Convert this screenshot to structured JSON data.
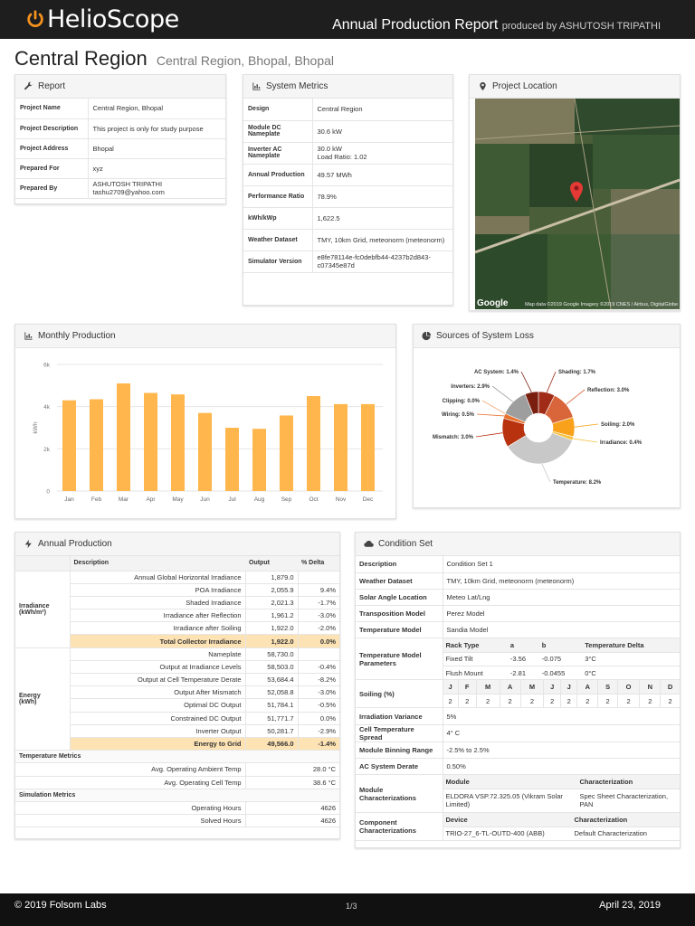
{
  "header": {
    "logo": "HelioScope",
    "title": "Annual Production Report",
    "produced_by": "produced by ASHUTOSH TRIPATHI"
  },
  "page": {
    "title": "Central Region",
    "subtitle": "Central Region, Bhopal, Bhopal"
  },
  "report": {
    "heading": "Report",
    "rows": [
      {
        "label": "Project Name",
        "value": "Central Region, Bhopal"
      },
      {
        "label": "Project Description",
        "value": "This project is only for study purpose"
      },
      {
        "label": "Project Address",
        "value": "Bhopal"
      },
      {
        "label": "Prepared For",
        "value": "xyz"
      },
      {
        "label": "Prepared By",
        "value": "ASHUTOSH TRIPATHI",
        "value2": "tashu2709@yahoo.com"
      }
    ]
  },
  "metrics": {
    "heading": "System Metrics",
    "rows": [
      {
        "label": "Design",
        "value": "Central Region"
      },
      {
        "label": "Module DC Nameplate",
        "value": "30.6 kW"
      },
      {
        "label": "Inverter AC Nameplate",
        "value": "30.0 kW",
        "value2": "Load Ratio: 1.02"
      },
      {
        "label": "Annual Production",
        "value": "49.57 MWh"
      },
      {
        "label": "Performance Ratio",
        "value": "78.9%"
      },
      {
        "label": "kWh/kWp",
        "value": "1,622.5"
      },
      {
        "label": "Weather Dataset",
        "value": "TMY, 10km Grid, meteonorm (meteonorm)"
      },
      {
        "label": "Simulator Version",
        "value": "e8fe78114e-fc0debfb44-4237b2d843-c07345e87d"
      }
    ]
  },
  "location": {
    "heading": "Project Location",
    "google": "Google",
    "credit": "Map data ©2019 Google  Imagery ©2019 CNES / Airbus, DigitalGlobe"
  },
  "monthly": {
    "heading": "Monthly Production"
  },
  "loss": {
    "heading": "Sources of System Loss"
  },
  "chart_data": [
    {
      "type": "bar",
      "title": "",
      "xlabel": "",
      "ylabel": "kWh",
      "ylim": [
        0,
        6000
      ],
      "yticks": [
        "0",
        "2k",
        "4k",
        "6k"
      ],
      "categories": [
        "Jan",
        "Feb",
        "Mar",
        "Apr",
        "May",
        "Jun",
        "Jul",
        "Aug",
        "Sep",
        "Oct",
        "Nov",
        "Dec"
      ],
      "values": [
        4300,
        4350,
        5100,
        4650,
        4580,
        3700,
        3000,
        2950,
        3580,
        4500,
        4120,
        4120
      ],
      "color": "#ffb74d",
      "grid": true
    },
    {
      "type": "pie",
      "title": "",
      "slices": [
        {
          "label": "Shading: 1.7%",
          "value": 1.7,
          "color": "#a02c18"
        },
        {
          "label": "Reflection: 3.0%",
          "value": 3.0,
          "color": "#d9663a"
        },
        {
          "label": "Soiling: 2.0%",
          "value": 2.0,
          "color": "#f9a11b"
        },
        {
          "label": "Irradiance: 0.4%",
          "value": 0.4,
          "color": "#f6c343"
        },
        {
          "label": "Temperature: 8.2%",
          "value": 8.2,
          "color": "#c8c8c8"
        },
        {
          "label": "Mismatch: 3.0%",
          "value": 3.0,
          "color": "#b83210"
        },
        {
          "label": "Wiring: 0.5%",
          "value": 0.5,
          "color": "#e8712c"
        },
        {
          "label": "Clipping: 0.0%",
          "value": 0.0,
          "color": "#f4a97a"
        },
        {
          "label": "Inverters: 2.9%",
          "value": 2.9,
          "color": "#9e9e9e"
        },
        {
          "label": "AC System: 1.4%",
          "value": 1.4,
          "color": "#7a1f10"
        }
      ]
    }
  ],
  "production": {
    "heading": "Annual Production",
    "col_desc": "Description",
    "col_output": "Output",
    "col_delta": "% Delta",
    "irradiance_label": "Irradiance",
    "irradiance_unit": "(kWh/m²)",
    "energy_label": "Energy",
    "energy_unit": "(kWh)",
    "irradiance": [
      {
        "desc": "Annual Global Horizontal Irradiance",
        "out": "1,879.0",
        "delta": ""
      },
      {
        "desc": "POA Irradiance",
        "out": "2,055.9",
        "delta": "9.4%"
      },
      {
        "desc": "Shaded Irradiance",
        "out": "2,021.3",
        "delta": "-1.7%"
      },
      {
        "desc": "Irradiance after Reflection",
        "out": "1,961.2",
        "delta": "-3.0%"
      },
      {
        "desc": "Irradiance after Soiling",
        "out": "1,922.0",
        "delta": "-2.0%"
      },
      {
        "desc": "Total Collector Irradiance",
        "out": "1,922.0",
        "delta": "0.0%",
        "total": true
      }
    ],
    "energy": [
      {
        "desc": "Nameplate",
        "out": "58,730.0",
        "delta": ""
      },
      {
        "desc": "Output at Irradiance Levels",
        "out": "58,503.0",
        "delta": "-0.4%"
      },
      {
        "desc": "Output at Cell Temperature Derate",
        "out": "53,684.4",
        "delta": "-8.2%"
      },
      {
        "desc": "Output After Mismatch",
        "out": "52,058.8",
        "delta": "-3.0%"
      },
      {
        "desc": "Optimal DC Output",
        "out": "51,784.1",
        "delta": "-0.5%"
      },
      {
        "desc": "Constrained DC Output",
        "out": "51,771.7",
        "delta": "0.0%"
      },
      {
        "desc": "Inverter Output",
        "out": "50,281.7",
        "delta": "-2.9%"
      },
      {
        "desc": "Energy to Grid",
        "out": "49,566.0",
        "delta": "-1.4%",
        "total": true
      }
    ],
    "temp_label": "Temperature Metrics",
    "temp": [
      {
        "desc": "Avg. Operating Ambient Temp",
        "out": "28.0 °C"
      },
      {
        "desc": "Avg. Operating Cell Temp",
        "out": "38.6 °C"
      }
    ],
    "sim_label": "Simulation Metrics",
    "sim": [
      {
        "desc": "Operating Hours",
        "out": "4626"
      },
      {
        "desc": "Solved Hours",
        "out": "4626"
      }
    ]
  },
  "condition": {
    "heading": "Condition Set",
    "description": {
      "label": "Description",
      "value": "Condition Set 1"
    },
    "weather": {
      "label": "Weather Dataset",
      "value": "TMY, 10km Grid, meteonorm (meteonorm)"
    },
    "solar": {
      "label": "Solar Angle Location",
      "value": "Meteo Lat/Lng"
    },
    "transposition": {
      "label": "Transposition Model",
      "value": "Perez Model"
    },
    "temperature": {
      "label": "Temperature Model",
      "value": "Sandia Model"
    },
    "tmp": {
      "label": "Temperature Model Parameters",
      "headers": [
        "Rack Type",
        "a",
        "b",
        "Temperature Delta"
      ],
      "rows": [
        [
          "Fixed Tilt",
          "-3.56",
          "-0.075",
          "3°C"
        ],
        [
          "Flush Mount",
          "-2.81",
          "-0.0455",
          "0°C"
        ]
      ]
    },
    "soiling": {
      "label": "Soiling (%)",
      "months": [
        "J",
        "F",
        "M",
        "A",
        "M",
        "J",
        "J",
        "A",
        "S",
        "O",
        "N",
        "D"
      ],
      "values": [
        "2",
        "2",
        "2",
        "2",
        "2",
        "2",
        "2",
        "2",
        "2",
        "2",
        "2",
        "2"
      ]
    },
    "irr_var": {
      "label": "Irradiation Variance",
      "value": "5%"
    },
    "cell_spread": {
      "label": "Cell Temperature Spread",
      "value": "4° C"
    },
    "binning": {
      "label": "Module Binning Range",
      "value": "-2.5% to 2.5%"
    },
    "ac_derate": {
      "label": "AC System Derate",
      "value": "0.50%"
    },
    "module_char": {
      "label": "Module Characterizations",
      "h1": "Module",
      "h2": "Characterization",
      "v1": "ELDORA VSP.72.325.05 (Vikram Solar Limited)",
      "v2": "Spec Sheet Characterization, PAN"
    },
    "comp_char": {
      "label": "Component Characterizations",
      "h1": "Device",
      "h2": "Characterization",
      "v1": "TRIO-27_6-TL-OUTD-400 (ABB)",
      "v2": "Default Characterization"
    }
  },
  "footer": {
    "copyright": "© 2019 Folsom Labs",
    "page": "1/3",
    "date": "April 23, 2019"
  }
}
